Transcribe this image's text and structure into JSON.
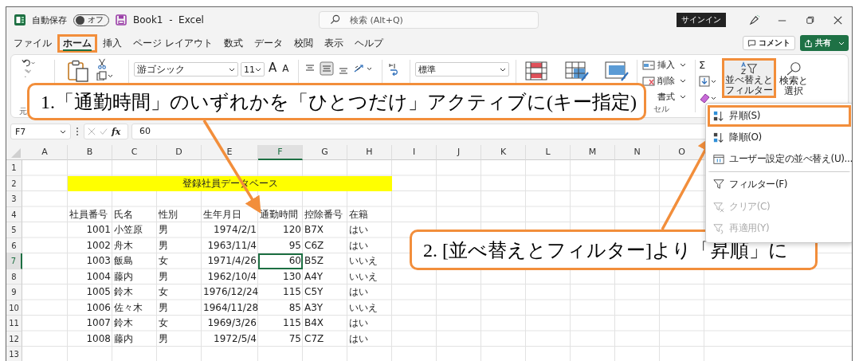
{
  "title_bar": {
    "autosave_label": "自動保存",
    "autosave": {
      "on": false,
      "label": "オフ"
    },
    "document_title": "Book1  -  Excel",
    "search": {
      "placeholder": "検索 (Alt+Q)"
    },
    "signin_button": "サインイン"
  },
  "menu_tabs": [
    {
      "label": "ファイル",
      "selected": false,
      "outlined": false
    },
    {
      "label": "ホーム",
      "selected": true,
      "outlined": true
    },
    {
      "label": "挿入",
      "selected": false,
      "outlined": false
    },
    {
      "label": "ページ レイアウト",
      "selected": false,
      "outlined": false
    },
    {
      "label": "数式",
      "selected": false,
      "outlined": false
    },
    {
      "label": "データ",
      "selected": false,
      "outlined": false
    },
    {
      "label": "校閲",
      "selected": false,
      "outlined": false
    },
    {
      "label": "表示",
      "selected": false,
      "outlined": false
    },
    {
      "label": "ヘルプ",
      "selected": false,
      "outlined": false
    }
  ],
  "comment_button": "コメント",
  "share_button": "共有",
  "ribbon": {
    "undo_group_label": "元",
    "font_name": "游ゴシック",
    "font_size": "11",
    "font_grow_button": "A",
    "font_shrink_button": "A",
    "number_format": "標準",
    "cell_commands": [
      {
        "label": "挿入",
        "kind": "insert"
      },
      {
        "label": "削除",
        "kind": "delete"
      },
      {
        "label": "書式",
        "kind": "format"
      }
    ],
    "cells_group_label": "セル",
    "autosum_button": "Σ",
    "sort_filter": {
      "label": "並べ替えと",
      "sublabel": "フィルター",
      "outlined": true
    },
    "find_select": {
      "label": "検索と",
      "sublabel": "選択"
    }
  },
  "formula_bar": {
    "name_box": "F7",
    "function_label": "fx",
    "formula": "60"
  },
  "sheet": {
    "columns": [
      {
        "label": "A",
        "selected": false
      },
      {
        "label": "B",
        "selected": false
      },
      {
        "label": "C",
        "selected": false
      },
      {
        "label": "D",
        "selected": false
      },
      {
        "label": "E",
        "selected": false
      },
      {
        "label": "F",
        "selected": true
      },
      {
        "label": "G",
        "selected": false
      },
      {
        "label": "H",
        "selected": false
      },
      {
        "label": "I",
        "selected": false
      },
      {
        "label": "J",
        "selected": false
      },
      {
        "label": "K",
        "selected": false
      },
      {
        "label": "L",
        "selected": false
      },
      {
        "label": "M",
        "selected": false
      },
      {
        "label": "N",
        "selected": false
      },
      {
        "label": "O",
        "selected": false
      }
    ],
    "rows": [
      {
        "label": "1",
        "selected": false
      },
      {
        "label": "2",
        "selected": false
      },
      {
        "label": "3",
        "selected": false
      },
      {
        "label": "4",
        "selected": false
      },
      {
        "label": "5",
        "selected": false
      },
      {
        "label": "6",
        "selected": false
      },
      {
        "label": "7",
        "selected": true
      },
      {
        "label": "8",
        "selected": false
      },
      {
        "label": "9",
        "selected": false
      },
      {
        "label": "10",
        "selected": false
      },
      {
        "label": "11",
        "selected": false
      },
      {
        "label": "12",
        "selected": false
      },
      {
        "label": "13",
        "selected": false
      }
    ],
    "title": "登録社員データベース",
    "table": {
      "columns": [
        {
          "label": "社員番号",
          "numeric": true
        },
        {
          "label": "氏名",
          "numeric": false
        },
        {
          "label": "性別",
          "numeric": false
        },
        {
          "label": "生年月日",
          "numeric": true
        },
        {
          "label": "通勤時間",
          "numeric": true
        },
        {
          "label": "控除番号",
          "numeric": false
        },
        {
          "label": "在籍",
          "numeric": false
        }
      ],
      "records": [
        {
          "values": [
            "1001",
            "小笠原",
            "男",
            "1974/2/1",
            "120",
            "B7X",
            "はい"
          ]
        },
        {
          "values": [
            "1002",
            "舟木",
            "男",
            "1963/11/4",
            "95",
            "C6Z",
            "はい"
          ]
        },
        {
          "values": [
            "1003",
            "飯島",
            "女",
            "1971/4/26",
            "60",
            "B5Z",
            "いいえ"
          ]
        },
        {
          "values": [
            "1004",
            "藤内",
            "男",
            "1962/10/4",
            "130",
            "A4Y",
            "いいえ"
          ]
        },
        {
          "values": [
            "1005",
            "鈴木",
            "女",
            "1976/12/24",
            "115",
            "C5Y",
            "はい"
          ]
        },
        {
          "values": [
            "1006",
            "佐々木",
            "男",
            "1964/11/28",
            "85",
            "A3Y",
            "いいえ"
          ]
        },
        {
          "values": [
            "1007",
            "鈴木",
            "女",
            "1969/3/26",
            "115",
            "B4X",
            "はい"
          ]
        },
        {
          "values": [
            "1008",
            "藤内",
            "男",
            "1972/5/4",
            "75",
            "C7Z",
            "はい"
          ]
        }
      ]
    }
  },
  "sort_menu": {
    "items": [
      {
        "label": "昇順(S)",
        "kind": "ascending",
        "disabled": false,
        "outlined": true,
        "separated": false
      },
      {
        "label": "降順(O)",
        "kind": "descending",
        "disabled": false,
        "outlined": false,
        "separated": false
      },
      {
        "label": "ユーザー設定の並べ替え(U)...",
        "kind": "custom",
        "disabled": false,
        "outlined": false,
        "separated": false
      },
      {
        "label": "フィルター(F)",
        "kind": "filter",
        "disabled": false,
        "outlined": false,
        "separated": true
      },
      {
        "label": "クリア(C)",
        "kind": "clear",
        "disabled": true,
        "outlined": false,
        "separated": false
      },
      {
        "label": "再適用(Y)",
        "kind": "reapply",
        "disabled": true,
        "outlined": false,
        "separated": false
      }
    ]
  },
  "callouts": [
    {
      "text": "1.「通勤時間」のいずれかを「ひとつだけ」アクティブに(キー指定)"
    },
    {
      "text": "2. [並べ替えとフィルター]より「昇順」に"
    }
  ]
}
